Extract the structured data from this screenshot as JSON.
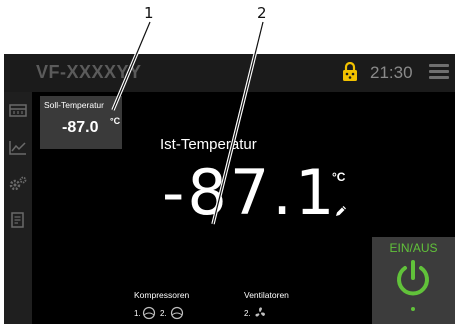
{
  "callouts": {
    "one": "1",
    "two": "2"
  },
  "header": {
    "device_name": "VF-XXXXYY",
    "time": "21:30"
  },
  "sidebar": {
    "icons": [
      "freezer-icon",
      "chart-icon",
      "settings-icon",
      "document-icon"
    ]
  },
  "setpoint": {
    "label": "Soll-Temperatur",
    "value": "-87.0",
    "unit": "°C"
  },
  "actual": {
    "label": "Ist-Temperatur",
    "value": "-87.1",
    "unit": "°C"
  },
  "status": {
    "compressors_label": "Kompressoren",
    "compressor_1": "1.",
    "compressor_2": "2.",
    "fans_label": "Ventilatoren",
    "fan_2": "2."
  },
  "power": {
    "label": "EIN/AUS"
  },
  "colors": {
    "accent_green": "#61c23a",
    "lock_yellow": "#f2c200"
  }
}
